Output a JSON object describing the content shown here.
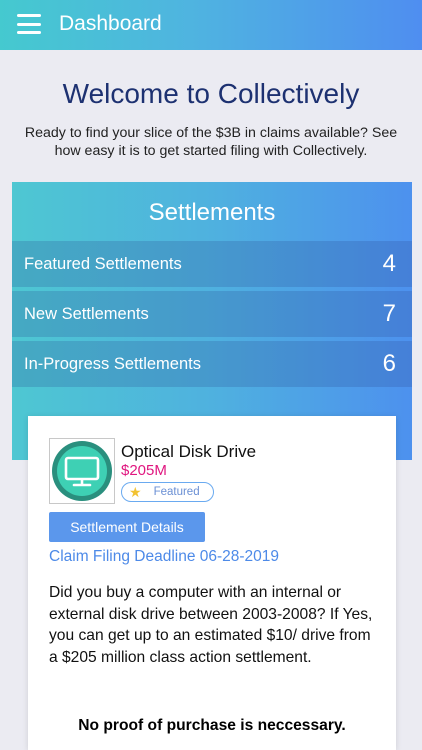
{
  "appbar": {
    "title": "Dashboard"
  },
  "welcome": {
    "heading": "Welcome to Collectively",
    "intro": "Ready to find your slice of the $3B in claims available? See how easy it is to get started filing with Collectively."
  },
  "settlements": {
    "title": "Settlements",
    "categories": [
      {
        "label": "Featured Settlements",
        "count": "4"
      },
      {
        "label": "New Settlements",
        "count": "7"
      },
      {
        "label": "In-Progress Settlements",
        "count": "6"
      }
    ]
  },
  "card": {
    "icon": "monitor-icon",
    "title": "Optical Disk Drive",
    "amount": "$205M",
    "badge": "Featured",
    "button_label": "Settlement Details",
    "deadline": "Claim Filing Deadline 06-28-2019",
    "description": "Did you buy a computer with an internal or external disk drive between 2003-2008? If Yes, you can get up to an estimated $10/ drive from a $205 million class action settlement.",
    "note": "No proof of purchase is neccessary."
  },
  "colors": {
    "accent_blue": "#4f8ef0",
    "teal": "#45c9cf",
    "amount_pink": "#e0167f",
    "heading_navy": "#1d3171"
  }
}
